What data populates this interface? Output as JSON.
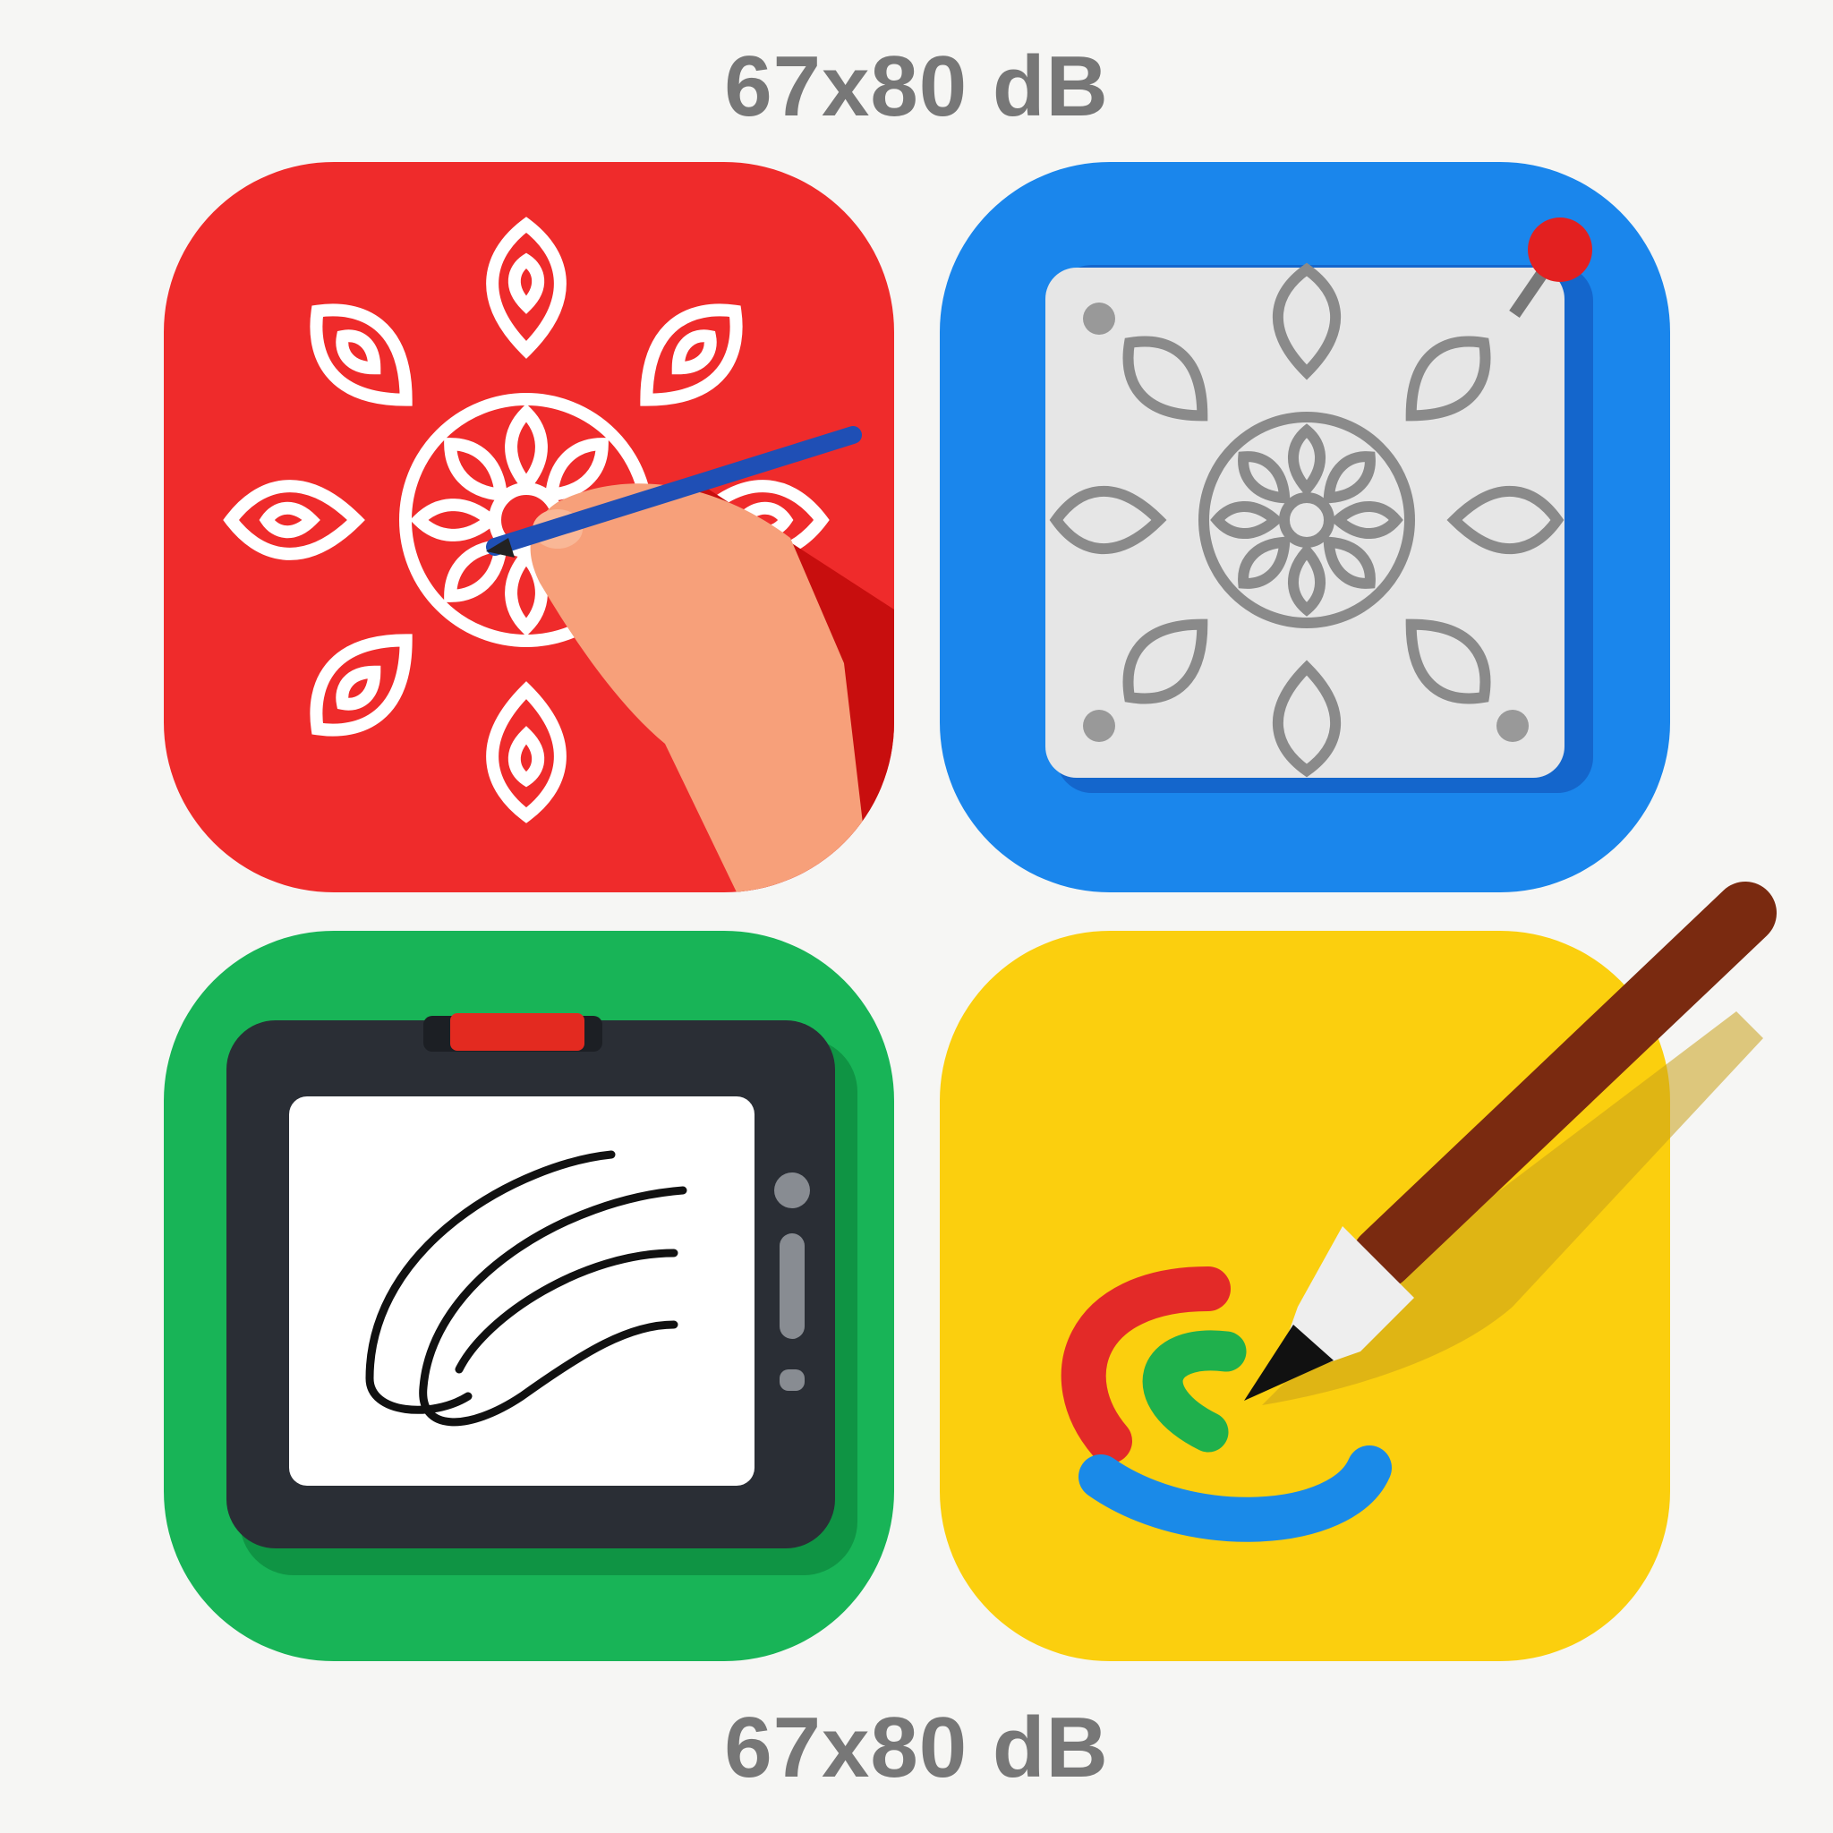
{
  "caption_top": "67x80 dB",
  "caption_bottom": "67x80 dB",
  "tiles": [
    {
      "icon": "mandala-drawing-hand-icon",
      "color": "#ef2b2b"
    },
    {
      "icon": "mandala-stencil-plate-icon",
      "color": "#1a86ec"
    },
    {
      "icon": "drawing-tablet-icon",
      "color": "#18b457"
    },
    {
      "icon": "paintbrush-strokes-icon",
      "color": "#fbcf0e"
    }
  ]
}
